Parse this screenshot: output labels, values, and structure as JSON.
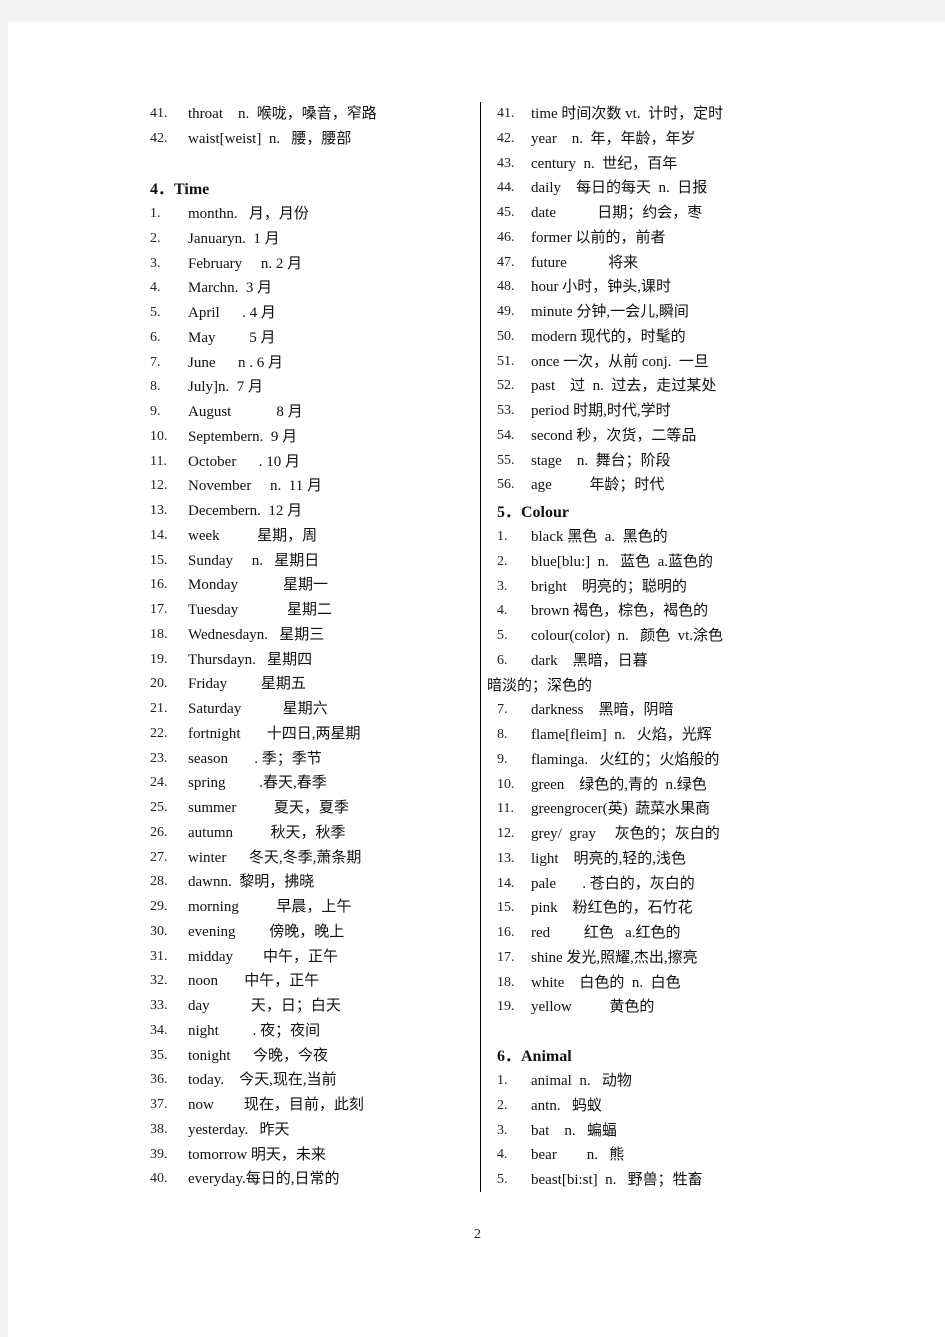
{
  "page_number": "2",
  "left_column": {
    "continued_items": [
      {
        "num": "41.",
        "text": "throat    n.  喉咙，嗓音，窄路"
      },
      {
        "num": "42.",
        "text": "waist[weist]  n.   腰，腰部"
      }
    ],
    "section_time": {
      "heading": "4．Time",
      "items": [
        {
          "num": "1.",
          "text": "monthn.   月，月份"
        },
        {
          "num": "2.",
          "text": "Januaryn.  1 月"
        },
        {
          "num": "3.",
          "text": "February     n. 2 月"
        },
        {
          "num": "4.",
          "text": "Marchn.  3 月"
        },
        {
          "num": "5.",
          "text": "April      . 4 月"
        },
        {
          "num": "6.",
          "text": "May         5 月"
        },
        {
          "num": "7.",
          "text": "June      n . 6 月"
        },
        {
          "num": "8.",
          "text": "July]n.  7 月"
        },
        {
          "num": "9.",
          "text": "August            8 月"
        },
        {
          "num": "10.",
          "text": "Septembern.  9 月"
        },
        {
          "num": "11.",
          "text": "October      . 10 月"
        },
        {
          "num": "12.",
          "text": "November     n.  11 月"
        },
        {
          "num": "13.",
          "text": "Decembern.  12 月"
        },
        {
          "num": "14.",
          "text": "week          星期，周"
        },
        {
          "num": "15.",
          "text": "Sunday     n.   星期日"
        },
        {
          "num": "16.",
          "text": "Monday            星期一"
        },
        {
          "num": "17.",
          "text": "Tuesday             星期二"
        },
        {
          "num": "18.",
          "text": "Wednesdayn.   星期三"
        },
        {
          "num": "19.",
          "text": "Thursdayn.   星期四"
        },
        {
          "num": "20.",
          "text": "Friday         星期五"
        },
        {
          "num": "21.",
          "text": "Saturday           星期六"
        },
        {
          "num": "22.",
          "text": "fortnight       十四日,两星期"
        },
        {
          "num": "23.",
          "text": "season       . 季；季节"
        },
        {
          "num": "24.",
          "text": "spring         .春天,春季"
        },
        {
          "num": "25.",
          "text": "summer          夏天，夏季"
        },
        {
          "num": "26.",
          "text": "autumn          秋天，秋季"
        },
        {
          "num": "27.",
          "text": "winter      冬天,冬季,萧条期"
        },
        {
          "num": "28.",
          "text": "dawnn.  黎明，拂晓"
        },
        {
          "num": "29.",
          "text": "morning          早晨，上午"
        },
        {
          "num": "30.",
          "text": "evening         傍晚，晚上"
        },
        {
          "num": "31.",
          "text": "midday        中午，正午"
        },
        {
          "num": "32.",
          "text": "noon       中午，正午"
        },
        {
          "num": "33.",
          "text": "day           天，日；白天"
        },
        {
          "num": "34.",
          "text": "night         . 夜；夜间"
        },
        {
          "num": "35.",
          "text": "tonight      今晚，今夜"
        },
        {
          "num": "36.",
          "text": "today.    今天,现在,当前"
        },
        {
          "num": "37.",
          "text": "now        现在，目前，此刻"
        },
        {
          "num": "38.",
          "text": "yesterday.   昨天"
        },
        {
          "num": "39.",
          "text": "tomorrow 明天，未来"
        },
        {
          "num": "40.",
          "text": "everyday.每日的,日常的"
        }
      ]
    }
  },
  "right_column": {
    "time_continued": [
      {
        "num": "41.",
        "text": "time 时间次数 vt.  计时，定时"
      },
      {
        "num": "42.",
        "text": "year    n.  年，年龄，年岁"
      },
      {
        "num": "43.",
        "text": "century  n.  世纪，百年"
      },
      {
        "num": "44.",
        "text": "daily    每日的每天  n.  日报"
      },
      {
        "num": "45.",
        "text": "date           日期；约会，枣"
      },
      {
        "num": "46.",
        "text": "former 以前的，前者"
      },
      {
        "num": "47.",
        "text": "future           将来"
      },
      {
        "num": "48.",
        "text": "hour 小时，钟头,课时"
      },
      {
        "num": "49.",
        "text": "minute 分钟,一会儿,瞬间"
      },
      {
        "num": "50.",
        "text": "modern 现代的，时髦的"
      },
      {
        "num": "51.",
        "text": "once 一次，从前 conj.  一旦"
      },
      {
        "num": "52.",
        "text": "past    过  n.  过去，走过某处"
      },
      {
        "num": "53.",
        "text": "period 时期,时代,学时"
      },
      {
        "num": "54.",
        "text": "second 秒，次货，二等品"
      },
      {
        "num": "55.",
        "text": "stage    n.  舞台；阶段"
      },
      {
        "num": "56.",
        "text": "age          年龄；时代"
      }
    ],
    "section_colour": {
      "heading": "5．Colour",
      "items": [
        {
          "num": "1.",
          "text": "black 黑色  a.  黑色的"
        },
        {
          "num": "2.",
          "text": "blue[blu:]  n.   蓝色  a.蓝色的"
        },
        {
          "num": "3.",
          "text": "bright    明亮的；聪明的"
        },
        {
          "num": "4.",
          "text": "brown 褐色，棕色，褐色的"
        },
        {
          "num": "5.",
          "text": "colour(color)  n.   颜色  vt.涂色"
        },
        {
          "num": "6.",
          "text": "dark    黑暗，日暮"
        }
      ],
      "wrap_text": "暗淡的；深色的",
      "items_after_wrap": [
        {
          "num": "7.",
          "text": "darkness    黑暗，阴暗"
        },
        {
          "num": "8.",
          "text": "flame[fleim]  n.   火焰，光辉"
        },
        {
          "num": "9.",
          "text": "flaminga.   火红的；火焰般的"
        },
        {
          "num": "10.",
          "text": "green    绿色的,青的  n.绿色"
        },
        {
          "num": "11.",
          "text": "greengrocer(英)  蔬菜水果商"
        },
        {
          "num": "12.",
          "text": "grey/  gray     灰色的；灰白的"
        },
        {
          "num": "13.",
          "text": "light    明亮的,轻的,浅色"
        },
        {
          "num": "14.",
          "text": "pale       . 苍白的，灰白的"
        },
        {
          "num": "15.",
          "text": "pink    粉红色的，石竹花"
        },
        {
          "num": "16.",
          "text": "red         红色   a.红色的"
        },
        {
          "num": "17.",
          "text": "shine 发光,照耀,杰出,擦亮"
        },
        {
          "num": "18.",
          "text": "white    白色的  n.  白色"
        },
        {
          "num": "19.",
          "text": "yellow          黄色的"
        }
      ]
    },
    "section_animal": {
      "heading": "6．Animal",
      "items": [
        {
          "num": "1.",
          "text": "animal  n.   动物"
        },
        {
          "num": "2.",
          "text": "antn.   蚂蚁"
        },
        {
          "num": "3.",
          "text": "bat    n.   蝙蝠"
        },
        {
          "num": "4.",
          "text": "bear        n.   熊"
        },
        {
          "num": "5.",
          "text": "beast[bi:st]  n.   野兽；牲畜"
        }
      ]
    }
  }
}
